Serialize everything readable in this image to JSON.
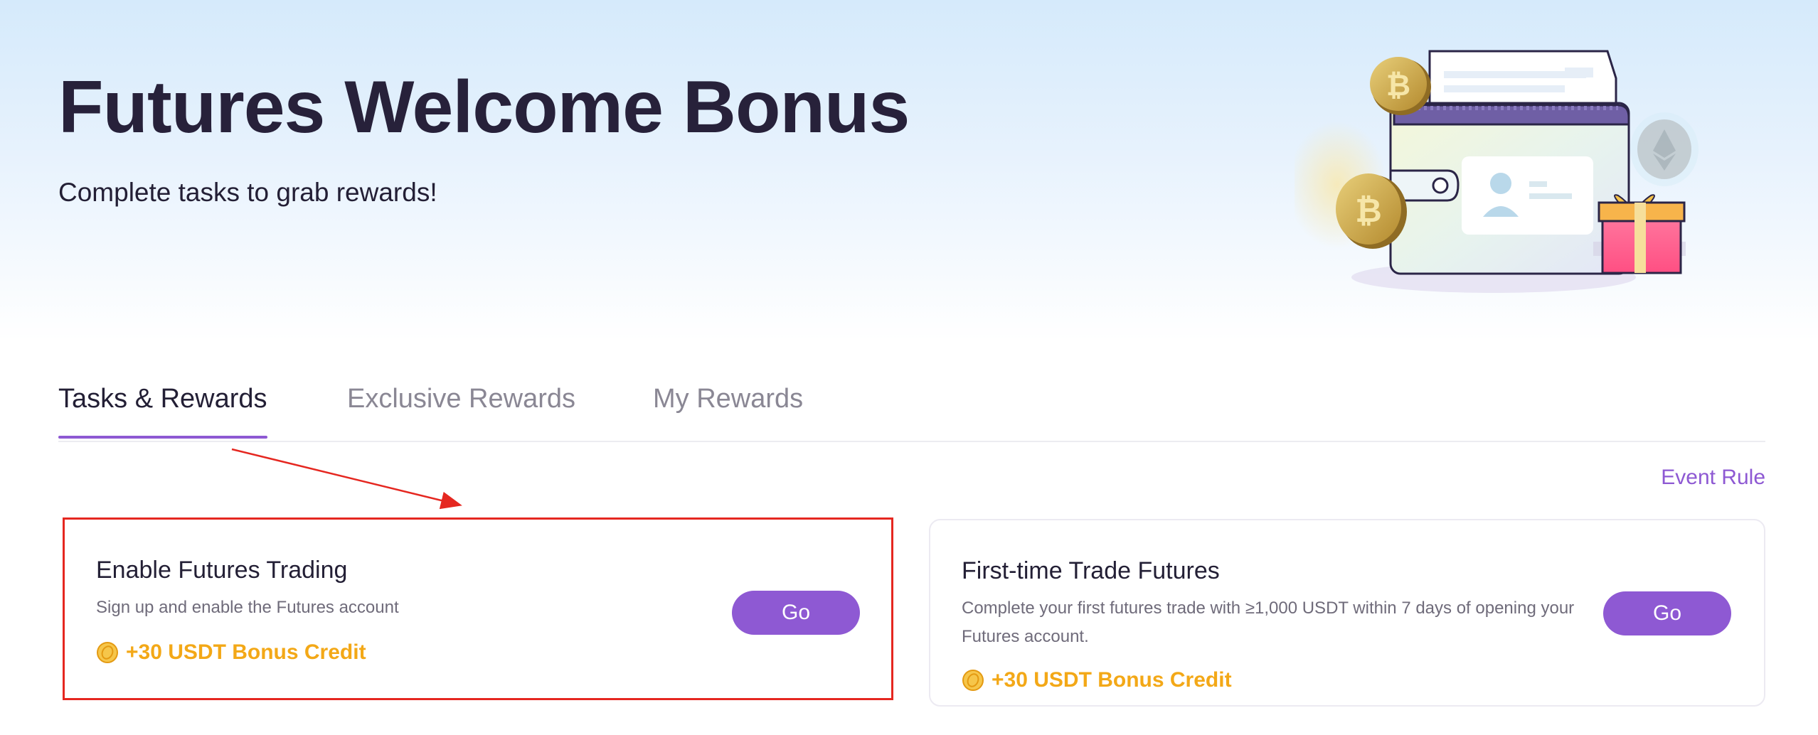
{
  "hero": {
    "title": "Futures Welcome Bonus",
    "subtitle": "Complete tasks to grab rewards!",
    "illustration": "wallet-with-crypto-coins-and-gift"
  },
  "tabs": [
    {
      "label": "Tasks & Rewards",
      "active": true
    },
    {
      "label": "Exclusive Rewards",
      "active": false
    },
    {
      "label": "My Rewards",
      "active": false
    }
  ],
  "event_rule_label": "Event Rule",
  "tasks": [
    {
      "title": "Enable Futures Trading",
      "description": "Sign up and enable the Futures account",
      "reward": "+30 USDT Bonus Credit",
      "button": "Go",
      "highlighted": true
    },
    {
      "title": "First-time Trade Futures",
      "description": "Complete your first futures trade with ≥1,000 USDT within 7 days of opening your Futures account.",
      "reward": "+30 USDT Bonus Credit",
      "button": "Go",
      "highlighted": false
    }
  ],
  "colors": {
    "accent": "#8e59d3",
    "reward": "#f3a817",
    "highlight_border": "#e52720",
    "title": "#27213a"
  },
  "icons": [
    "bitcoin-coin-icon",
    "ethereum-coin-icon",
    "gift-box-icon",
    "wallet-icon",
    "coin-icon"
  ]
}
